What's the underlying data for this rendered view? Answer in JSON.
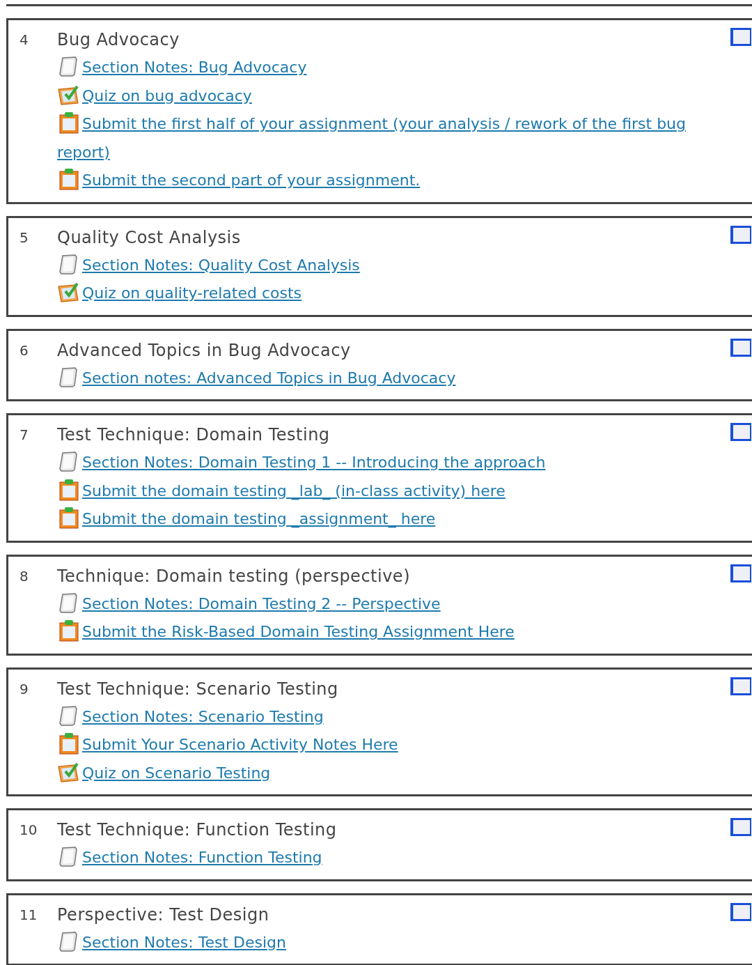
{
  "sections": [
    {
      "number": "4",
      "title": "Bug Advocacy",
      "items": [
        {
          "kind": "notes",
          "text": "Section Notes: Bug Advocacy"
        },
        {
          "kind": "quiz",
          "text": "Quiz on bug advocacy"
        },
        {
          "kind": "assignment",
          "text": "Submit the first half of your assignment (your analysis / rework of the first bug report)"
        },
        {
          "kind": "assignment",
          "text": "Submit the second part of your assignment."
        }
      ]
    },
    {
      "number": "5",
      "title": "Quality Cost Analysis",
      "items": [
        {
          "kind": "notes",
          "text": "Section Notes: Quality Cost Analysis"
        },
        {
          "kind": "quiz",
          "text": "Quiz on quality-related costs"
        }
      ]
    },
    {
      "number": "6",
      "title": "Advanced Topics in Bug Advocacy",
      "items": [
        {
          "kind": "notes",
          "text": "Section notes: Advanced Topics in Bug Advocacy"
        }
      ]
    },
    {
      "number": "7",
      "title": "Test Technique: Domain Testing",
      "items": [
        {
          "kind": "notes",
          "text": "Section Notes: Domain Testing 1 -- Introducing the approach"
        },
        {
          "kind": "assignment",
          "text": "Submit the domain testing _lab_ (in-class activity) here"
        },
        {
          "kind": "assignment",
          "text": "Submit the domain testing _assignment_ here"
        }
      ]
    },
    {
      "number": "8",
      "title": "Technique: Domain testing (perspective)",
      "items": [
        {
          "kind": "notes",
          "text": "Section Notes: Domain Testing 2 -- Perspective"
        },
        {
          "kind": "assignment",
          "text": "Submit the Risk-Based Domain Testing Assignment Here"
        }
      ]
    },
    {
      "number": "9",
      "title": "Test Technique: Scenario Testing",
      "items": [
        {
          "kind": "notes",
          "text": "Section Notes: Scenario Testing"
        },
        {
          "kind": "assignment",
          "text": "Submit Your Scenario Activity Notes Here"
        },
        {
          "kind": "quiz",
          "text": "Quiz on Scenario Testing"
        }
      ]
    },
    {
      "number": "10",
      "title": "Test Technique: Function Testing",
      "items": [
        {
          "kind": "notes",
          "text": "Section Notes: Function Testing"
        }
      ]
    },
    {
      "number": "11",
      "title": "Perspective: Test Design",
      "items": [
        {
          "kind": "notes",
          "text": "Section Notes: Test Design"
        }
      ]
    }
  ]
}
